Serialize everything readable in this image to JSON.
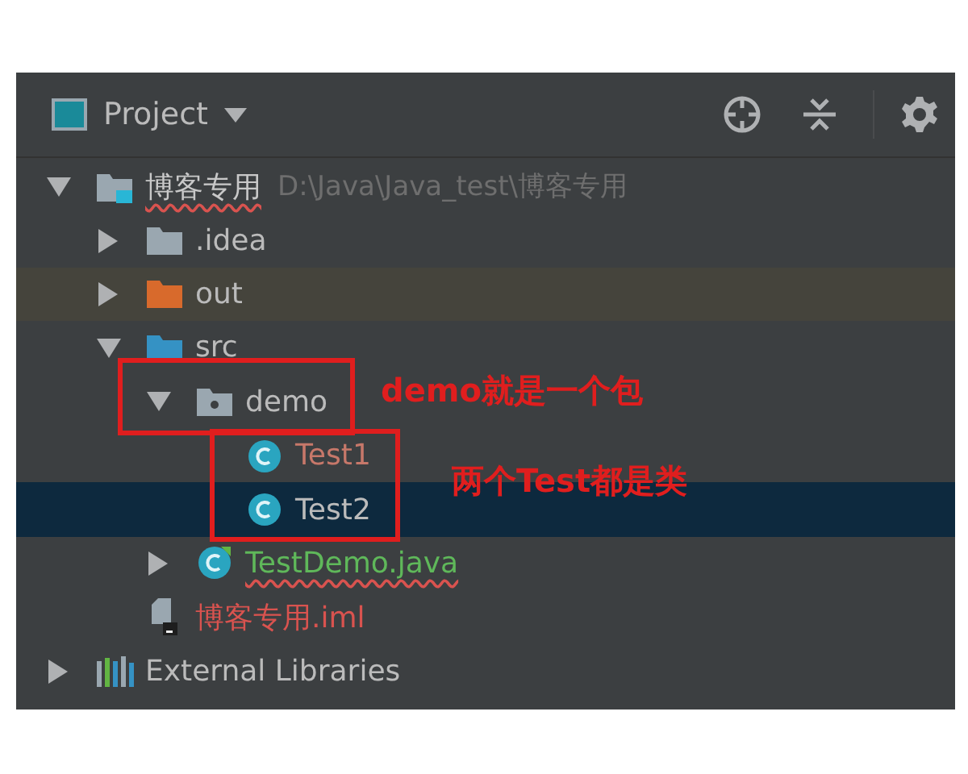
{
  "panel": {
    "title": "Project"
  },
  "tree": [
    {
      "label": "博客专用",
      "path": "D:\\Java\\Java_test\\博客专用",
      "kind": "module",
      "expanded": true,
      "selected": false,
      "error": true,
      "color": "#c8c8c8",
      "children": [
        {
          "label": ".idea",
          "kind": "folder",
          "expanded": false,
          "selected": false,
          "error": false,
          "color": "#bbbbbb"
        },
        {
          "label": "out",
          "kind": "excluded",
          "expanded": false,
          "selected": false,
          "error": false,
          "color": "#bbbbbb"
        },
        {
          "label": "src",
          "kind": "source",
          "expanded": true,
          "selected": false,
          "error": false,
          "color": "#bbbbbb",
          "children": [
            {
              "label": "demo",
              "kind": "package",
              "expanded": true,
              "selected": false,
              "error": false,
              "color": "#bbbbbb",
              "children": [
                {
                  "label": "Test1",
                  "kind": "class",
                  "selected": false,
                  "error": false,
                  "color": "#c7786a"
                },
                {
                  "label": "Test2",
                  "kind": "class",
                  "selected": true,
                  "error": false,
                  "color": "#bbbbbb"
                }
              ]
            },
            {
              "label": "TestDemo.java",
              "kind": "class-file",
              "expanded": false,
              "selected": false,
              "error": true,
              "color": "#5fb85a"
            }
          ]
        },
        {
          "label": "博客专用.iml",
          "kind": "file",
          "selected": false,
          "error": false,
          "color": "#d9534f"
        }
      ]
    },
    {
      "label": "External Libraries",
      "kind": "library",
      "expanded": false,
      "selected": false,
      "error": false,
      "color": "#bbbbbb"
    }
  ],
  "annotations": [
    {
      "text": "demo就是一个包"
    },
    {
      "text": "两个Test都是类"
    }
  ]
}
